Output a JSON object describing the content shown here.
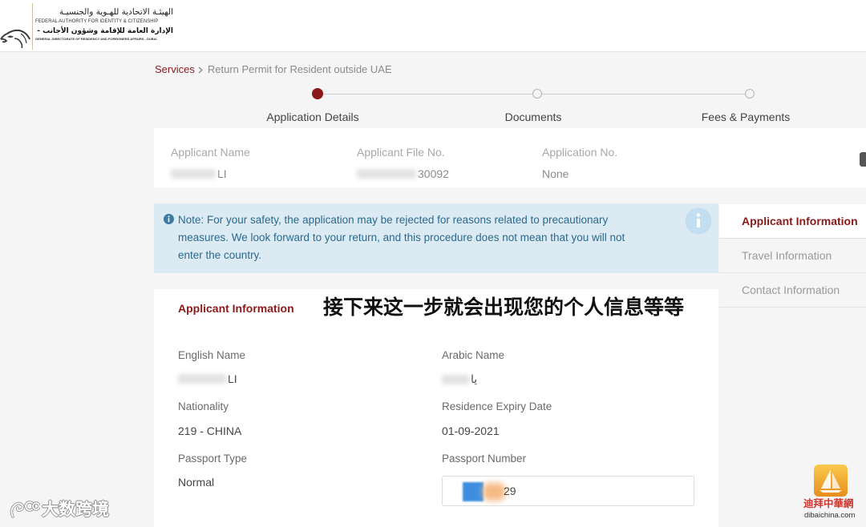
{
  "header": {
    "logo_icon": "falcon-icon",
    "authority_ar": "الهيئـة الاتحادية للهـوية والجنسيـة",
    "authority_en": "FEDERAL AUTHORITY FOR IDENTITY & CITIZENSHIP",
    "directorate_ar": "الإدارة العامة للإقامة وشؤون الأجانب - دبي",
    "directorate_en": "GENERAL DIRECTORATE OF RESIDENCY AND FOREIGNERS AFFAIRS - DUBAI"
  },
  "breadcrumb": {
    "root": "Services",
    "separator_icon": "chevron-right-icon",
    "current": "Return Permit for Resident outside UAE"
  },
  "stepper": {
    "steps": [
      {
        "label": "Application Details",
        "current": true
      },
      {
        "label": "Documents",
        "current": false
      },
      {
        "label": "Fees & Payments",
        "current": false
      }
    ]
  },
  "summary": {
    "fields": [
      {
        "label": "Applicant Name",
        "value": "LI"
      },
      {
        "label": "Applicant File No.",
        "value": "30092"
      },
      {
        "label": "Application No.",
        "value": "None"
      }
    ]
  },
  "note": {
    "icon": "info-circle-icon",
    "lines": [
      "Note: For your safety, the application may be rejected for reasons related to precautionary",
      "measures. We look forward to your return, and this procedure does not mean that you will not",
      "enter the country."
    ]
  },
  "side_nav": {
    "items": [
      {
        "label": "Applicant Information",
        "active": true
      },
      {
        "label": "Travel Information",
        "active": false
      },
      {
        "label": "Contact Information",
        "active": false
      }
    ]
  },
  "applicant_section": {
    "title": "Applicant Information",
    "fields": [
      {
        "label": "English Name",
        "value": "LI"
      },
      {
        "label": "Arabic Name",
        "value": "يا"
      },
      {
        "label": "Nationality",
        "value": "219 - CHINA"
      },
      {
        "label": "Residence Expiry Date",
        "value": "01-09-2021"
      },
      {
        "label": "Passport Type",
        "value": "Normal"
      },
      {
        "label": "Passport Number",
        "value": "29"
      }
    ]
  },
  "overlay_caption": "接下来这一步就会出现您的个人信息等等",
  "watermarks": {
    "left_text": "大数跨境",
    "right_name": "迪拜中華網",
    "right_site": "dibaichina.com"
  },
  "colors": {
    "brand": "#8b1a1a",
    "page_bg": "#f5f5f5",
    "note_bg": "#dbeaf3",
    "note_text": "#2b6a8d"
  }
}
